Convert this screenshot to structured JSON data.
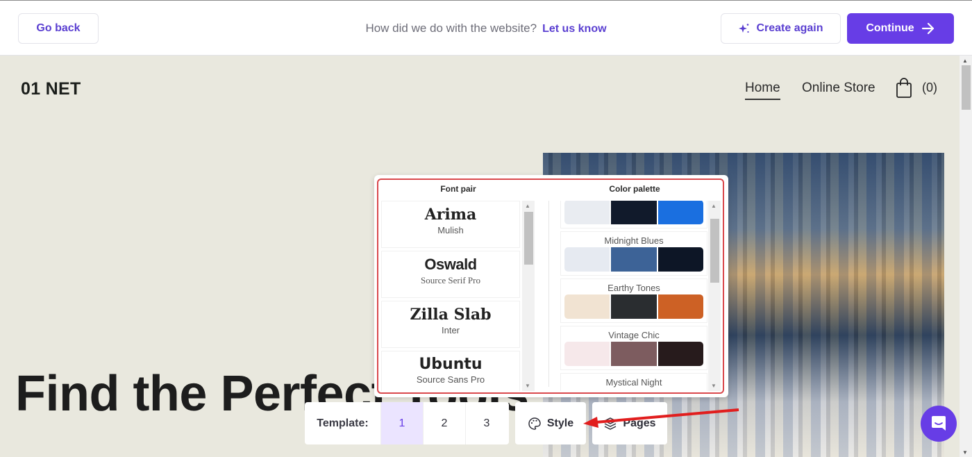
{
  "topbar": {
    "back_label": "Go back",
    "feedback_question": "How did we do with the website?",
    "feedback_link": "Let us know",
    "create_again_label": "Create again",
    "continue_label": "Continue",
    "accent_color": "#673de6"
  },
  "site": {
    "logo": "01 NET",
    "nav": [
      {
        "label": "Home",
        "active": true
      },
      {
        "label": "Online Store",
        "active": false
      }
    ],
    "cart_count": "(0)",
    "hero_title": "Find the Perfect Tools"
  },
  "style_panel": {
    "font_pair_title": "Font pair",
    "color_palette_title": "Color palette",
    "font_pairs": [
      {
        "heading": "Arima",
        "body": "Mulish"
      },
      {
        "heading": "Oswald",
        "body": "Source Serif Pro"
      },
      {
        "heading": "Zilla Slab",
        "body": "Inter"
      },
      {
        "heading": "Ubuntu",
        "body": "Source Sans Pro"
      }
    ],
    "palettes": [
      {
        "name": "",
        "colors": [
          "#e9ecf1",
          "#111a2b",
          "#1a6fe0"
        ]
      },
      {
        "name": "Midnight Blues",
        "colors": [
          "#e6eaf1",
          "#3d6397",
          "#0d1626"
        ]
      },
      {
        "name": "Earthy Tones",
        "colors": [
          "#f1e3d2",
          "#2a2d30",
          "#cd6125"
        ]
      },
      {
        "name": "Vintage Chic",
        "colors": [
          "#f6e8ea",
          "#7d5c5f",
          "#271b1c"
        ]
      },
      {
        "name": "Mystical Night",
        "colors": []
      }
    ]
  },
  "toolbar": {
    "template_label": "Template:",
    "template_options": [
      "1",
      "2",
      "3"
    ],
    "selected_template": "1",
    "style_label": "Style",
    "pages_label": "Pages"
  }
}
